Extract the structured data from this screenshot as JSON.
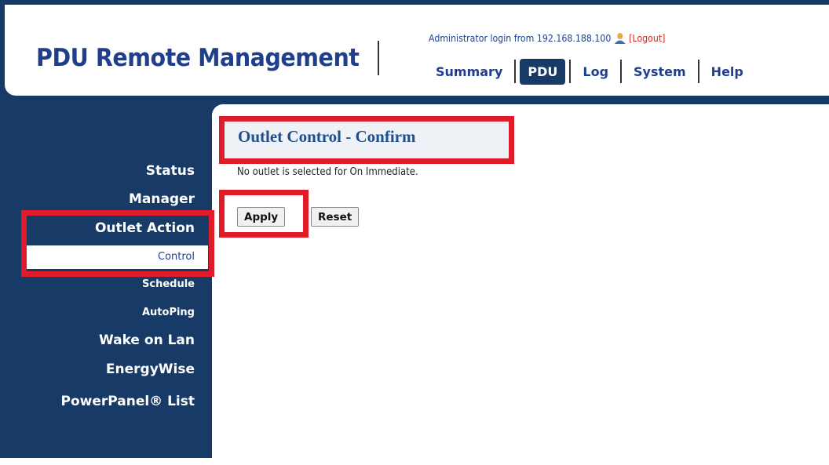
{
  "header": {
    "brand": "PDU Remote Management",
    "login_text": "Administrator login from 192.168.188.100",
    "logout_text": "[Logout]",
    "nav": {
      "summary": "Summary",
      "pdu": "PDU",
      "log": "Log",
      "system": "System",
      "help": "Help"
    }
  },
  "sidebar": {
    "status": "Status",
    "manager": "Manager",
    "outlet_action": "Outlet Action",
    "control": "Control",
    "schedule": "Schedule",
    "autoping": "AutoPing",
    "wake_on_lan": "Wake on Lan",
    "energywise": "EnergyWise",
    "powerpanel_list": "PowerPanel® List"
  },
  "main": {
    "title": "Outlet Control - Confirm",
    "message": "No outlet is selected for On Immediate.",
    "apply_label": "Apply",
    "reset_label": "Reset"
  },
  "colors": {
    "navy": "#173a66",
    "brand_blue": "#1f3f8c",
    "highlight_red": "#e01b2a",
    "logout_red": "#d2281e"
  },
  "icons": {
    "user": "user-icon"
  }
}
